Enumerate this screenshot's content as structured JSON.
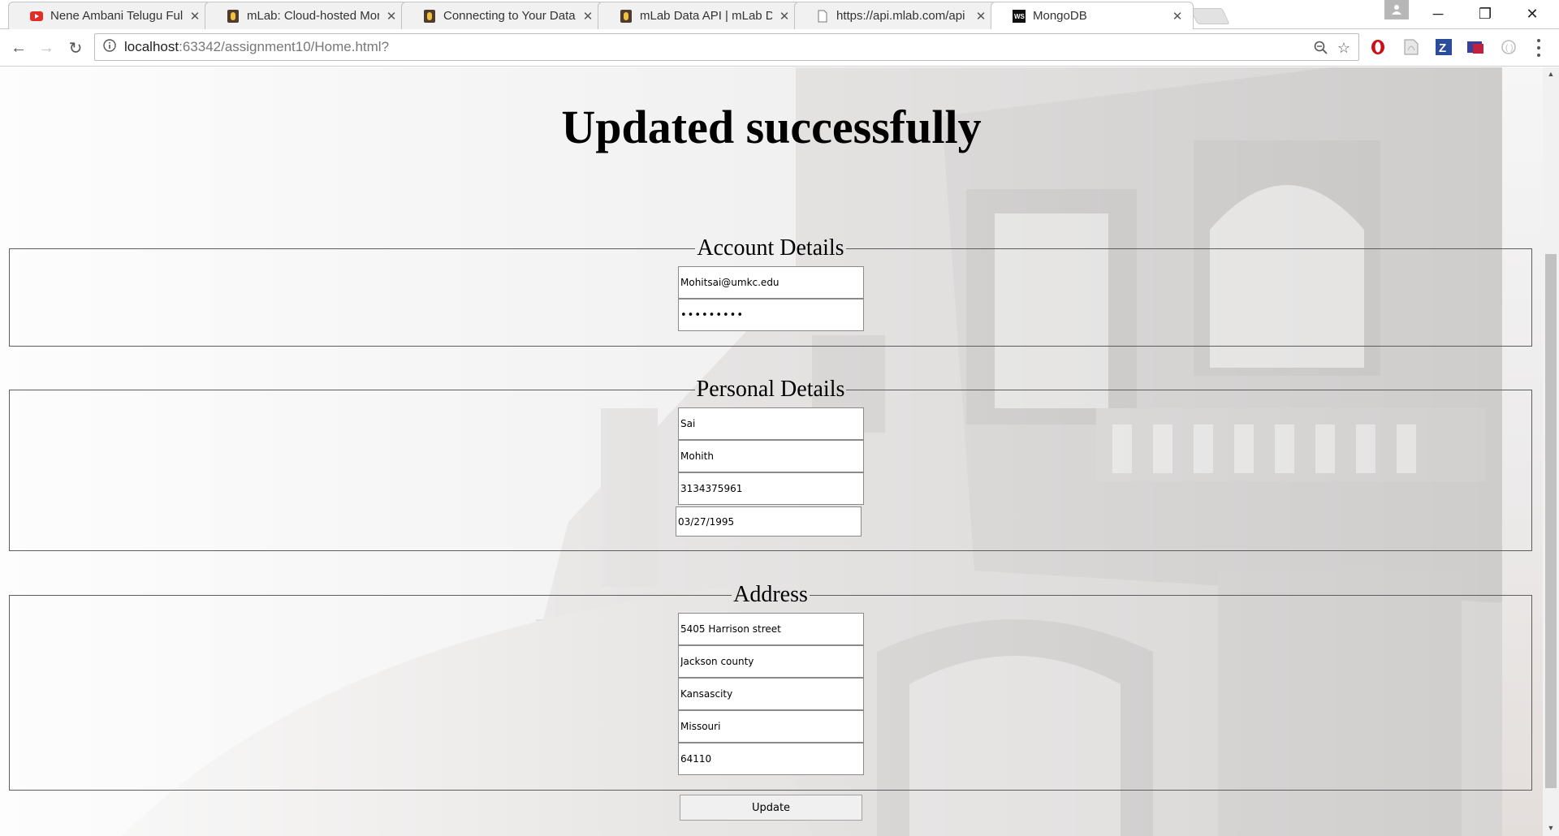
{
  "tabs": [
    {
      "title": "Nene Ambani Telugu Full",
      "favicon": "youtube-icon"
    },
    {
      "title": "mLab: Cloud-hosted Mon",
      "favicon": "mlab-icon"
    },
    {
      "title": "Connecting to Your Data",
      "favicon": "mlab-icon"
    },
    {
      "title": "mLab Data API | mLab De",
      "favicon": "mlab-icon"
    },
    {
      "title": "https://api.mlab.com/api",
      "favicon": "document-icon"
    },
    {
      "title": "MongoDB",
      "favicon": "webstorm-icon"
    }
  ],
  "address_bar": {
    "host": "localhost",
    "rest": ":63342/assignment10/Home.html?"
  },
  "page": {
    "heading": "Updated successfully",
    "account": {
      "legend": "Account Details",
      "email": "Mohitsai@umkc.edu",
      "password_mask": "•••••••••"
    },
    "personal": {
      "legend": "Personal Details",
      "first_name": "Sai",
      "last_name": "Mohith",
      "phone": "3134375961",
      "dob": "03/27/1995"
    },
    "address": {
      "legend": "Address",
      "street": "5405 Harrison street",
      "county": "Jackson county",
      "city": "Kansascity",
      "state": "Missouri",
      "zip": "64110"
    },
    "update_label": "Update"
  },
  "colors": {
    "youtube": "#e52d27",
    "mlab": "#4f3b2e",
    "opera": "#cc0f16"
  }
}
